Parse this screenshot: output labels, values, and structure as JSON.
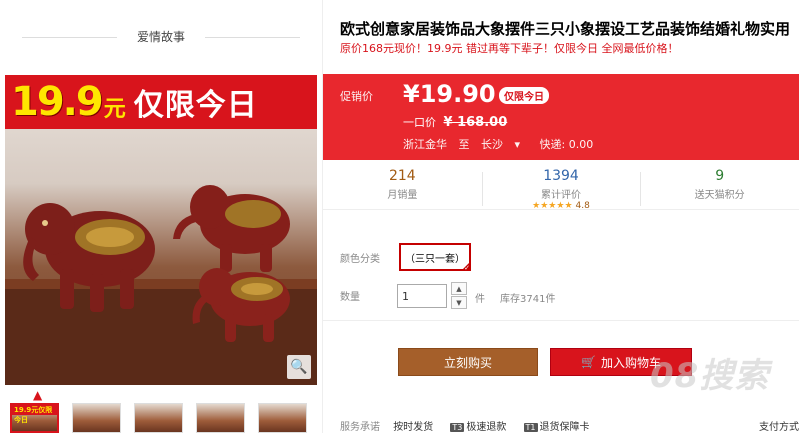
{
  "left": {
    "story_title": "爱情故事",
    "promo_price": "19.9",
    "promo_unit": "元",
    "promo_text": "仅限今日",
    "thumb_banner": "19.9元仅限今日",
    "zoom_icon": "magnifier-icon",
    "thumb_count": 5
  },
  "product": {
    "title": "欧式创意家居装饰品大象摆件三只小象摆设工艺品装饰结婚礼物实用",
    "subtitle": "原价168元现价！19.9元 错过再等下辈子！仅限今日 全网最低价格！"
  },
  "price": {
    "label": "促销价",
    "value": "¥19.90",
    "tag": "仅限今日",
    "orig_label": "一口价",
    "orig_value": "¥ 168.00",
    "ship_from": "浙江金华",
    "ship_to_label": "至",
    "ship_to": "长沙",
    "shipping": "快递: 0.00"
  },
  "stats": [
    {
      "value": "214",
      "label": "月销量"
    },
    {
      "value": "1394",
      "label": "累计评价",
      "rating": "4.8"
    },
    {
      "value": "9",
      "label": "送天猫积分"
    }
  ],
  "options": {
    "color_label": "颜色分类",
    "color_selected": "（三只一套）",
    "qty_label": "数量",
    "qty_value": "1",
    "qty_unit": "件",
    "stock": "库存3741件"
  },
  "actions": {
    "buy": "立刻购买",
    "cart": "加入购物车"
  },
  "service": {
    "label": "服务承诺",
    "items": [
      {
        "badge": "",
        "text": "按时发货"
      },
      {
        "badge": "T3",
        "text": "极速退款"
      },
      {
        "badge": "T1",
        "text": "退货保障卡"
      }
    ],
    "more": "支付方式"
  },
  "watermark": "08搜索",
  "colors": {
    "accent": "#d8141c",
    "price_box": "#e8282e",
    "buy_button": "#a55f2a"
  }
}
